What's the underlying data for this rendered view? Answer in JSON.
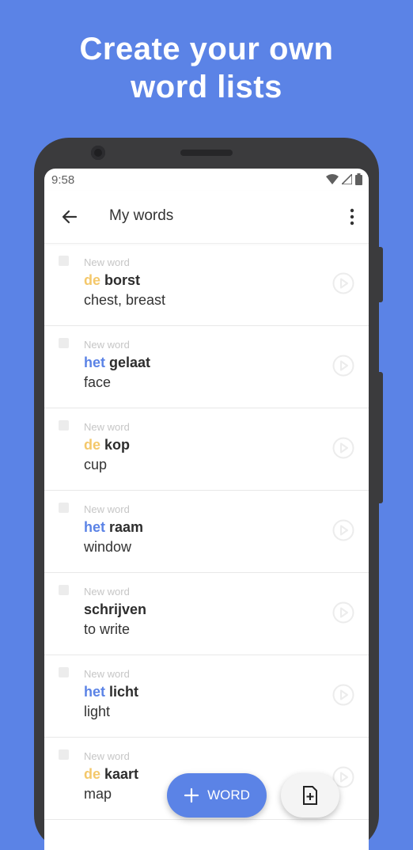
{
  "headline": {
    "line1": "Create your own",
    "line2": "word lists"
  },
  "status_bar": {
    "time": "9:58",
    "icons": [
      "wifi-icon",
      "signal-icon",
      "battery-icon"
    ]
  },
  "app_bar": {
    "title": "My words",
    "back_icon": "arrow-left-icon",
    "menu_icon": "more-vertical-icon"
  },
  "words": [
    {
      "tag": "New word",
      "article": "de",
      "word": "borst",
      "translation": "chest, breast"
    },
    {
      "tag": "New word",
      "article": "het",
      "word": "gelaat",
      "translation": "face"
    },
    {
      "tag": "New word",
      "article": "de",
      "word": "kop",
      "translation": "cup"
    },
    {
      "tag": "New word",
      "article": "het",
      "word": "raam",
      "translation": "window"
    },
    {
      "tag": "New word",
      "article": "",
      "word": "schrijven",
      "translation": "to write"
    },
    {
      "tag": "New word",
      "article": "het",
      "word": "licht",
      "translation": "light"
    },
    {
      "tag": "New word",
      "article": "de",
      "word": "kaart",
      "translation": "map"
    }
  ],
  "fab": {
    "add_word_label": "WORD",
    "add_word_icon": "plus-icon",
    "import_icon": "file-plus-icon"
  },
  "colors": {
    "background": "#5b83e6",
    "article_de": "#f4c86b",
    "article_het": "#5b83e6"
  }
}
